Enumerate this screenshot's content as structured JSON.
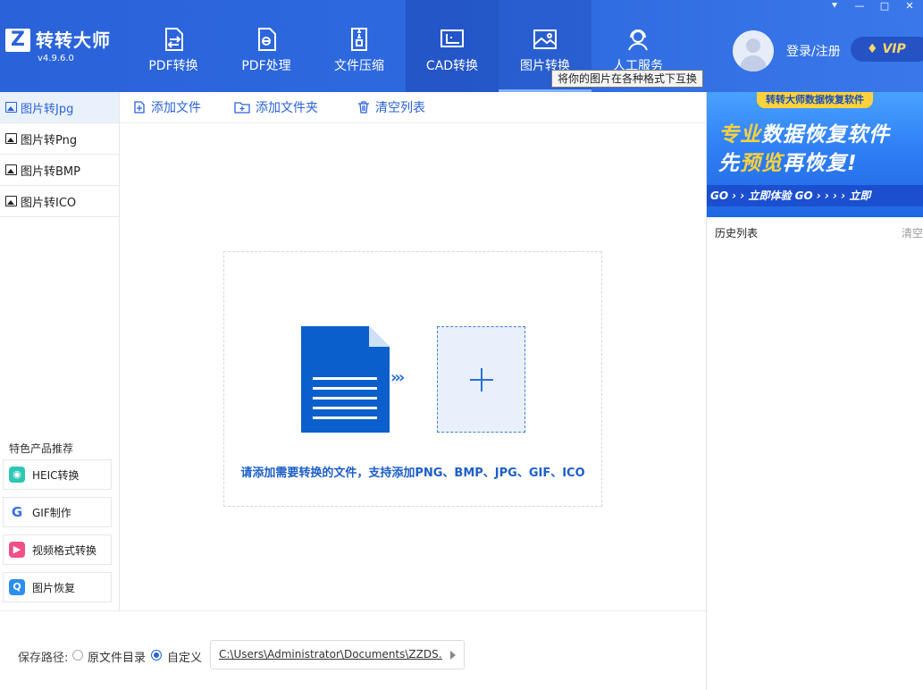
{
  "app": {
    "title": "转转大师",
    "version": "v4.9.6.0",
    "logo_letter": "Z"
  },
  "nav": {
    "items": [
      {
        "label": "PDF转换",
        "icon": "pdf-convert-icon"
      },
      {
        "label": "PDF处理",
        "icon": "pdf-process-icon"
      },
      {
        "label": "文件压缩",
        "icon": "zip-icon"
      },
      {
        "label": "CAD转换",
        "icon": "cad-icon"
      },
      {
        "label": "图片转换",
        "icon": "image-icon"
      },
      {
        "label": "人工服务",
        "icon": "support-icon"
      }
    ],
    "active_index": 4,
    "tooltip": "将你的图片在各种格式下互换"
  },
  "account": {
    "login_label": "登录/注册",
    "vip_label": "VIP"
  },
  "sidebar": {
    "items": [
      {
        "label": "图片转Jpg"
      },
      {
        "label": "图片转Png"
      },
      {
        "label": "图片转BMP"
      },
      {
        "label": "图片转ICO"
      }
    ],
    "active_index": 0,
    "featured_title": "特色产品推荐",
    "featured": [
      {
        "label": "HEIC转换",
        "icon": "heic-icon",
        "color": "#2ec7b3"
      },
      {
        "label": "GIF制作",
        "icon": "gif-icon",
        "color": "#3b6fe0"
      },
      {
        "label": "视频格式转换",
        "icon": "video-icon",
        "color": "#f0508a"
      },
      {
        "label": "图片恢复",
        "icon": "photo-restore-icon",
        "color": "#2b8ef0"
      }
    ]
  },
  "toolbar": {
    "add_file": "添加文件",
    "add_folder": "添加文件夹",
    "clear_list": "清空列表"
  },
  "dropzone": {
    "hint": "请添加需要转换的文件，支持添加PNG、BMP、JPG、GIF、ICO"
  },
  "output": {
    "save_path_label": "保存路径:",
    "option_original": "原文件目录",
    "option_custom": "自定义",
    "selected": "custom",
    "path": "C:\\Users\\Administrator\\Documents\\ZZDS..."
  },
  "right_panel": {
    "banner_tag": "转转大师数据恢复软件",
    "banner_line1_hl": "专业",
    "banner_line1_rest": "数据恢复软件",
    "banner_line2_a": "先",
    "banner_line2_hl": "预览",
    "banner_line2_b": "再恢复!",
    "banner_strip": "GO › › 立即体验 GO › › › › 立即",
    "history_title": "历史列表",
    "history_clear": "清空"
  },
  "colors": {
    "brand": "#2a62d9",
    "accent_yellow": "#ffd23c"
  }
}
